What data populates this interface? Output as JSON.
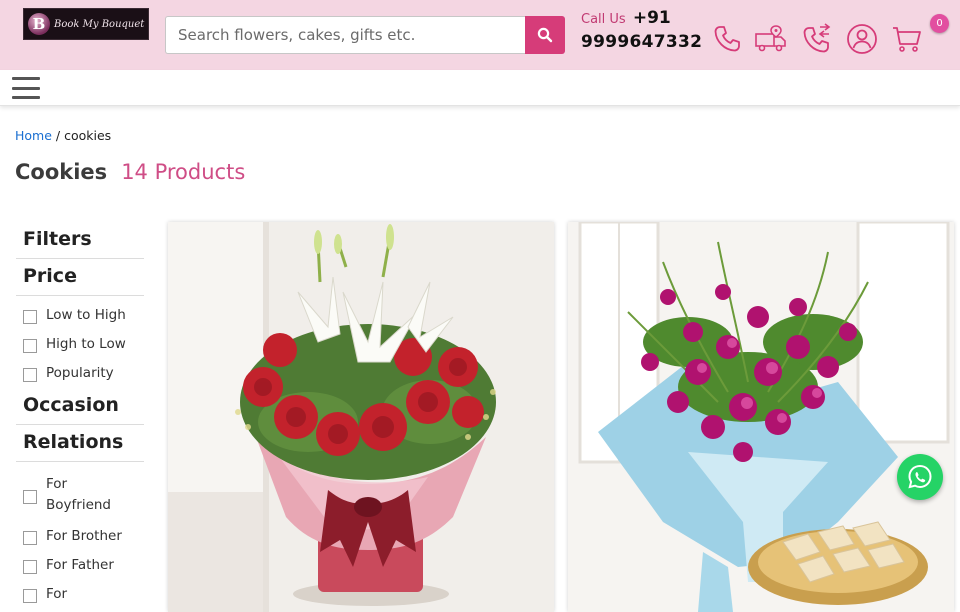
{
  "header": {
    "logo_text": "Book My Bouquet",
    "logo_letter": "B",
    "search_placeholder": "Search flowers, cakes, gifts etc.",
    "call_label": "Call Us",
    "call_prefix": "+91",
    "call_number": "9999647332",
    "icons": [
      "phone-icon",
      "delivery-truck-icon",
      "call-forward-icon",
      "user-account-icon",
      "cart-icon"
    ],
    "cart_count": "0",
    "accent_color": "#d63c79",
    "bar_color": "#f4d6e2"
  },
  "breadcrumb": {
    "home": "Home",
    "separator": " / ",
    "current": "cookies"
  },
  "page": {
    "title": "Cookies",
    "count": "14 Products"
  },
  "filters": {
    "heading": "Filters",
    "price": {
      "heading": "Price",
      "options": [
        "Low to High",
        "High to Low",
        "Popularity"
      ]
    },
    "occasion": {
      "heading": "Occasion"
    },
    "relations": {
      "heading": "Relations",
      "options": [
        "For Boyfriend",
        "For Brother",
        "For Father",
        "For"
      ]
    }
  },
  "products": [
    {
      "image": "red-roses-white-lilies-bouquet"
    },
    {
      "image": "purple-orchids-bouquet-with-kaju-katli"
    }
  ],
  "whatsapp_icon": "whatsapp-icon"
}
